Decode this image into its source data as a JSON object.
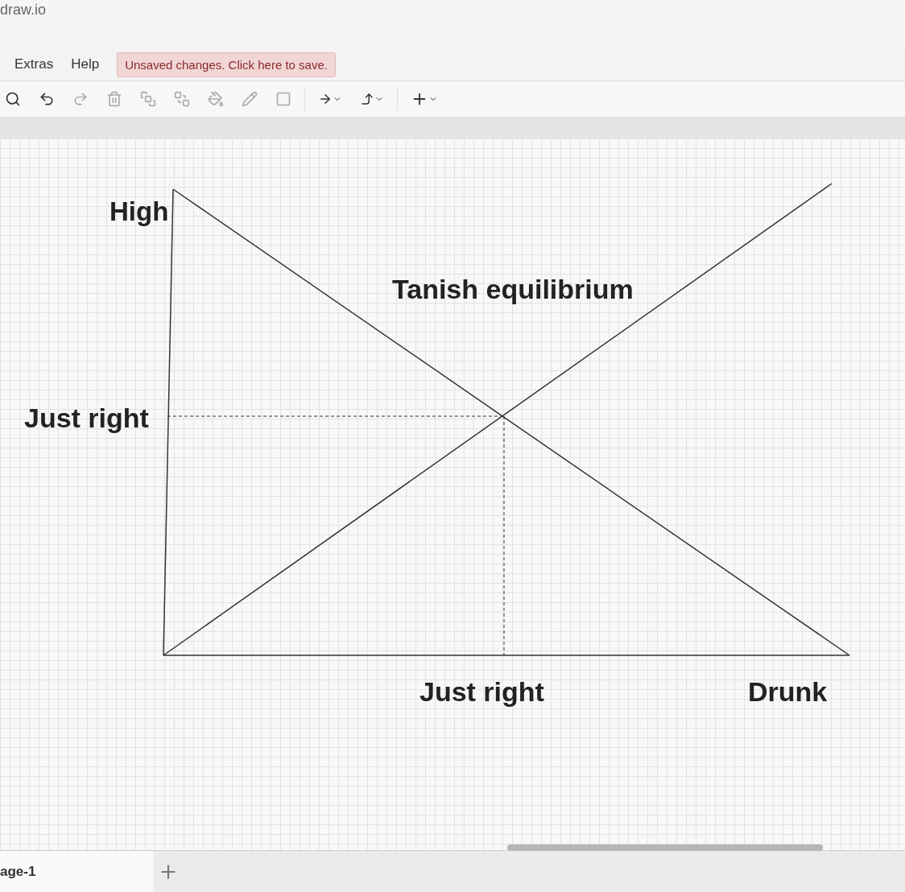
{
  "window": {
    "title": "draw.io"
  },
  "menu": [
    "Extras",
    "Help"
  ],
  "save_notice": "Unsaved changes. Click here to save.",
  "diagram": {
    "labels": [
      {
        "kind": "y-top",
        "text": "High"
      },
      {
        "kind": "center",
        "text": "Tanish equilibrium"
      },
      {
        "kind": "y-mid",
        "text": "Just right"
      },
      {
        "kind": "x-mid",
        "text": "Just right"
      },
      {
        "kind": "x-end",
        "text": "Drunk"
      }
    ]
  },
  "pages": [
    {
      "label": "age-1",
      "selected": true
    }
  ]
}
